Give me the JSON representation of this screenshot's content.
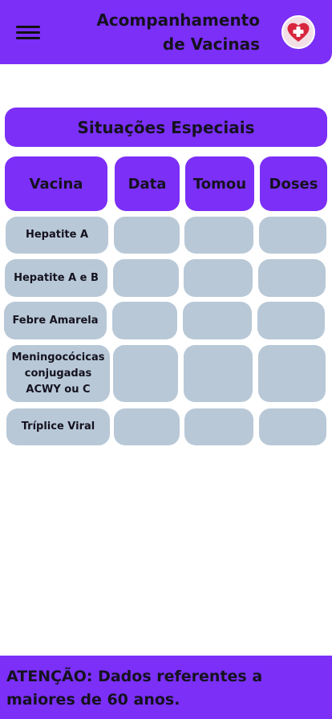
{
  "header": {
    "title_line1": "Acompanhamento",
    "title_line2": "de Vacinas",
    "menu_icon": "hamburger-menu-icon",
    "logo_icon": "heart-medical-cross-icon"
  },
  "section": {
    "title": "Situações Especiais"
  },
  "table": {
    "columns": [
      "Vacina",
      "Data",
      "Tomou",
      "Doses"
    ],
    "rows": [
      {
        "vacina": "Hepatite A",
        "data": "",
        "tomou": "",
        "doses": ""
      },
      {
        "vacina": "Hepatite A e B",
        "data": "",
        "tomou": "",
        "doses": ""
      },
      {
        "vacina": "Febre Amarela",
        "data": "",
        "tomou": "",
        "doses": ""
      },
      {
        "vacina": "Meningocócicas conjugadas ACWY ou C",
        "data": "",
        "tomou": "",
        "doses": ""
      },
      {
        "vacina": "Tríplice Viral",
        "data": "",
        "tomou": "",
        "doses": ""
      }
    ]
  },
  "footer": {
    "notice": "ATENÇÃO: Dados referentes a maiores de 60 anos."
  },
  "colors": {
    "primary": "#7b2ff7",
    "cell": "#b8c8d7",
    "text": "#15121f",
    "logo_red": "#d7263d"
  }
}
